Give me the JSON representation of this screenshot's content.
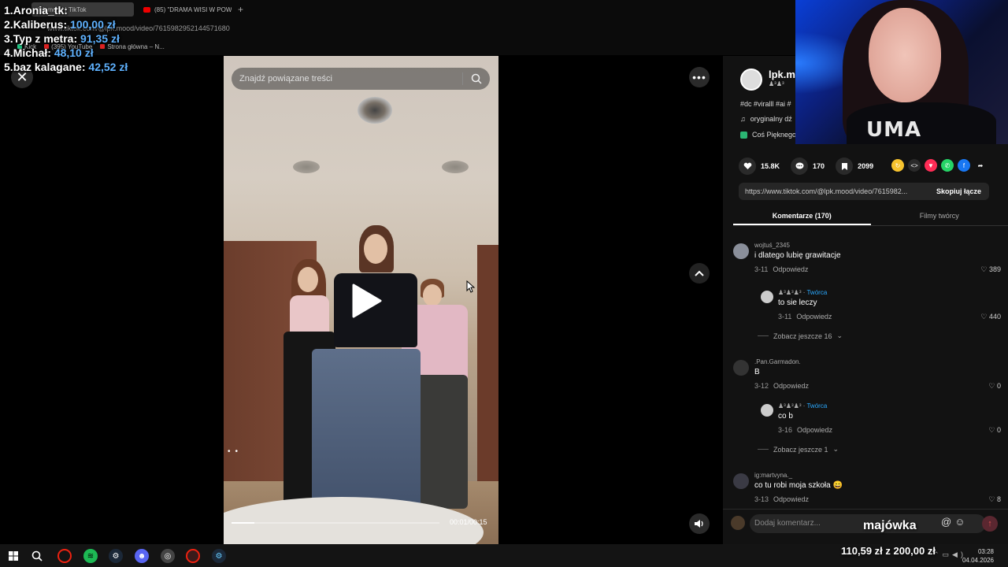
{
  "browser": {
    "tabs": [
      {
        "label": "lpk.mood | TikTok",
        "active": true
      },
      {
        "label": "(85) \"DRAMA WISI W POW",
        "active": false
      }
    ],
    "url": "www.tiktok.com/@lpk.mood/video/7615982952144571680",
    "bookmarks": [
      "Kick",
      "(395) YouTube",
      "Strona główna – N..."
    ]
  },
  "donations": [
    {
      "rank": "1.",
      "name": "Aronia_tk:",
      "amount": ""
    },
    {
      "rank": "2.",
      "name": "Kaliberus:",
      "amount": "100,00 zł"
    },
    {
      "rank": "3.",
      "name": "Typ z metra:",
      "amount": "91,35 zł"
    },
    {
      "rank": "4.",
      "name": "Michał:",
      "amount": "48,10 zł"
    },
    {
      "rank": "5.",
      "name": "baz kalagane:",
      "amount": "42,52 zł"
    }
  ],
  "video": {
    "search_placeholder": "Znajdź powiązane treści",
    "time": "00:01/00:15",
    "progress": 0.11
  },
  "author": {
    "handle": "lpk.mo",
    "description": "#dc #viralll #ai #",
    "music": "oryginalny dź",
    "effect": "Coś Pięknego"
  },
  "stats": {
    "likes": "15.8K",
    "comments": "170",
    "saves": "2099"
  },
  "link": {
    "url": "https://www.tiktok.com/@lpk.mood/video/7615982...",
    "copy_label": "Skopiuj łącze"
  },
  "panel_tabs": {
    "comments": "Komentarze (170)",
    "creator_videos": "Filmy twórcy"
  },
  "comments": [
    {
      "name": "wojtuś_2345",
      "text": "i dlatego lubię grawitacje",
      "date": "3-11",
      "reply": "Odpowiedz",
      "likes": "389"
    },
    {
      "name": "Twórca",
      "text": "to sie leczy",
      "date": "3-11",
      "reply": "Odpowiedz",
      "likes": "440",
      "is_reply": true
    },
    {
      "more": "Zobacz jeszcze 16"
    },
    {
      "name": ".Pan.Garmadon.",
      "text": "B",
      "date": "3-12",
      "reply": "Odpowiedz",
      "likes": "0"
    },
    {
      "name": "Twórca",
      "text": "co b",
      "date": "3-16",
      "reply": "Odpowiedz",
      "likes": "0",
      "is_reply": true
    },
    {
      "more": "Zobacz jeszcze 1"
    },
    {
      "name": "ig:martvyna._",
      "text": "co tu robi moja szkoła 😄",
      "date": "3-13",
      "reply": "Odpowiedz",
      "likes": "8"
    }
  ],
  "comment_bar": {
    "placeholder": "Dodaj komentarz..."
  },
  "overlay": {
    "majowka": "majówka",
    "goal": "110,59 zł z 200,00 zł"
  },
  "webcam_shirt_text": "UMA",
  "taskbar": {
    "time": "03:28",
    "date": "04.04.2026"
  }
}
